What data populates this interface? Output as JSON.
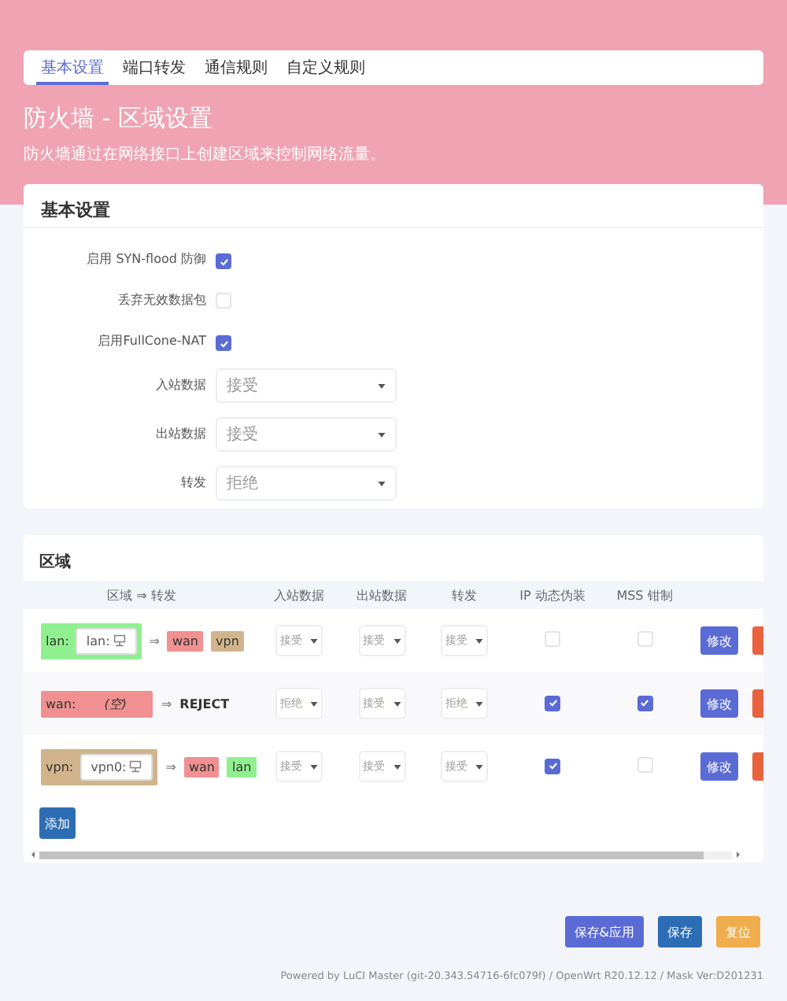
{
  "tabs": [
    {
      "label": "基本设置",
      "selected": true
    },
    {
      "label": "端口转发",
      "selected": false
    },
    {
      "label": "通信规则",
      "selected": false
    },
    {
      "label": "自定义规则",
      "selected": false
    }
  ],
  "title": "防火墙 - 区域设置",
  "description": "防火墙通过在网络接口上创建区域来控制网络流量。",
  "basic": {
    "title": "基本设置",
    "rows": [
      {
        "kind": "checkbox",
        "label": "启用 SYN-flood 防御",
        "checked": true
      },
      {
        "kind": "checkbox",
        "label": "丢弃无效数据包",
        "checked": false
      },
      {
        "kind": "checkbox",
        "label": "启用FullCone-NAT",
        "checked": true
      },
      {
        "kind": "select",
        "label": "入站数据",
        "value": "接受"
      },
      {
        "kind": "select",
        "label": "出站数据",
        "value": "接受"
      },
      {
        "kind": "select",
        "label": "转发",
        "value": "拒绝"
      }
    ]
  },
  "zones": {
    "title": "区域",
    "columns": [
      "区域 ⇒ 转发",
      "入站数据",
      "出站数据",
      "转发",
      "IP 动态伪装",
      "MSS 钳制"
    ],
    "rows": [
      {
        "zone": "lan:",
        "color": "#90f090",
        "devices": [
          "lan:"
        ],
        "arrow": "⇒",
        "forwards": [
          {
            "kind": "zone",
            "label": "wan",
            "color": "#f09090"
          },
          {
            "kind": "zone",
            "label": "vpn",
            "color": "#d2b48c"
          }
        ],
        "input": "接受",
        "output": "接受",
        "forward": "接受",
        "masq": false,
        "mss": false,
        "edit": "修改"
      },
      {
        "zone": "wan:",
        "color": "#f09090",
        "empty": "(空)",
        "arrow": "⇒",
        "forwards": [
          {
            "kind": "policy",
            "label": "REJECT"
          }
        ],
        "input": "拒绝",
        "output": "接受",
        "forward": "拒绝",
        "masq": true,
        "mss": true,
        "edit": "修改"
      },
      {
        "zone": "vpn:",
        "color": "#d2b48c",
        "devices": [
          "vpn0:"
        ],
        "arrow": "⇒",
        "forwards": [
          {
            "kind": "zone",
            "label": "wan",
            "color": "#f09090"
          },
          {
            "kind": "zone",
            "label": "lan",
            "color": "#90f090"
          }
        ],
        "input": "接受",
        "output": "接受",
        "forward": "接受",
        "masq": true,
        "mss": false,
        "edit": "修改"
      }
    ],
    "add": "添加"
  },
  "actions": [
    {
      "kind": "apply",
      "label": "保存&应用"
    },
    {
      "kind": "save",
      "label": "保存"
    },
    {
      "kind": "reset",
      "label": "复位"
    }
  ],
  "footer": "Powered by LuCI Master (git-20.343.54716-6fc079f) / OpenWrt R20.12.12 / Mask Ver:D201231"
}
